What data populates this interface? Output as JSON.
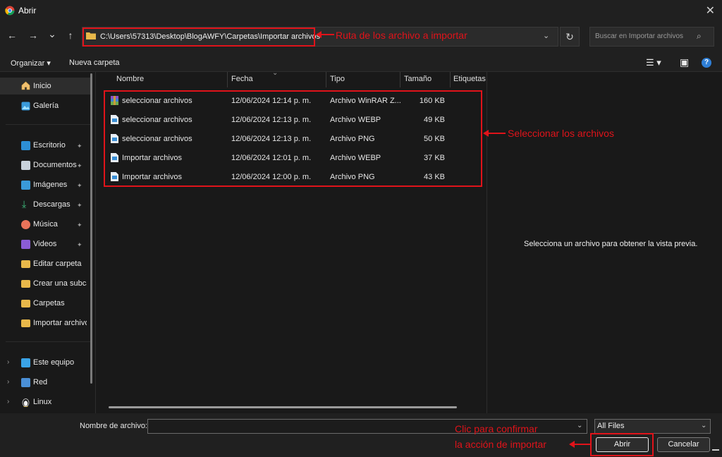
{
  "window": {
    "title": "Abrir",
    "close_glyph": "✕"
  },
  "nav": {
    "back_glyph": "←",
    "forward_glyph": "→",
    "recent_glyph": "⌄",
    "up_glyph": "↑",
    "address": "C:\\Users\\57313\\Desktop\\BlogAWFY\\Carpetas\\Importar archivos",
    "address_chevron": "⌄",
    "refresh_glyph": "↻",
    "search_placeholder": "Buscar en Importar archivos",
    "search_glyph": "⌕"
  },
  "toolbar": {
    "organize": "Organizar ▾",
    "new_folder": "Nueva carpeta",
    "view_glyph": "☰ ▾",
    "pane_glyph": "▣",
    "help_glyph": "?"
  },
  "sidebar": {
    "top_items": [
      {
        "label": "Inicio",
        "icon": "home-icon"
      },
      {
        "label": "Galería",
        "icon": "gallery-icon"
      }
    ],
    "pinned_items": [
      {
        "label": "Escritorio",
        "icon": "desktop-icon",
        "pinned": true
      },
      {
        "label": "Documentos",
        "icon": "documents-icon",
        "pinned": true
      },
      {
        "label": "Imágenes",
        "icon": "pictures-icon",
        "pinned": true
      },
      {
        "label": "Descargas",
        "icon": "downloads-icon",
        "pinned": true
      },
      {
        "label": "Música",
        "icon": "music-icon",
        "pinned": true
      },
      {
        "label": "Videos",
        "icon": "videos-icon",
        "pinned": true
      },
      {
        "label": "Editar carpeta",
        "icon": "folder-icon"
      },
      {
        "label": "Crear una subcarpeta",
        "icon": "folder-icon"
      },
      {
        "label": "Carpetas",
        "icon": "folder-icon"
      },
      {
        "label": "Importar archivos",
        "icon": "folder-icon"
      }
    ],
    "tree_items": [
      {
        "label": "Este equipo",
        "icon": "computer-icon"
      },
      {
        "label": "Red",
        "icon": "network-icon"
      },
      {
        "label": "Linux",
        "icon": "linux-icon"
      }
    ],
    "pin_glyph": "📌",
    "expand_glyph": "›"
  },
  "columns": {
    "name": "Nombre",
    "date": "Fecha",
    "type": "Tipo",
    "size": "Tamaño",
    "tags": "Etiquetas",
    "sort_glyph": "⌄"
  },
  "files": [
    {
      "name": "seleccionar archivos",
      "date": "12/06/2024 12:14 p. m.",
      "type": "Archivo WinRAR Z...",
      "size": "160 KB",
      "icon": "winrar-archive-icon"
    },
    {
      "name": "seleccionar archivos",
      "date": "12/06/2024 12:13 p. m.",
      "type": "Archivo WEBP",
      "size": "49 KB",
      "icon": "image-file-icon"
    },
    {
      "name": "seleccionar archivos",
      "date": "12/06/2024 12:13 p. m.",
      "type": "Archivo PNG",
      "size": "50 KB",
      "icon": "image-file-icon"
    },
    {
      "name": "Importar archivos",
      "date": "12/06/2024 12:01 p. m.",
      "type": "Archivo WEBP",
      "size": "37 KB",
      "icon": "image-file-icon"
    },
    {
      "name": "Importar archivos",
      "date": "12/06/2024 12:00 p. m.",
      "type": "Archivo PNG",
      "size": "43 KB",
      "icon": "image-file-icon"
    }
  ],
  "preview": {
    "message": "Selecciona un archivo para obtener la vista previa."
  },
  "footer": {
    "filename_label": "Nombre de archivo:",
    "filename_value": "",
    "filter_value": "All Files",
    "open_label": "Abrir",
    "cancel_label": "Cancelar"
  },
  "annotations": {
    "path_note": "Ruta de los archivo a importar",
    "files_note": "Seleccionar los archivos",
    "confirm_note_line1": "Clic para confirmar",
    "confirm_note_line2": "la acción de importar"
  },
  "colors": {
    "annotation_red": "#e0131a",
    "background": "#191919",
    "folder_yellow": "#e8b84a"
  }
}
